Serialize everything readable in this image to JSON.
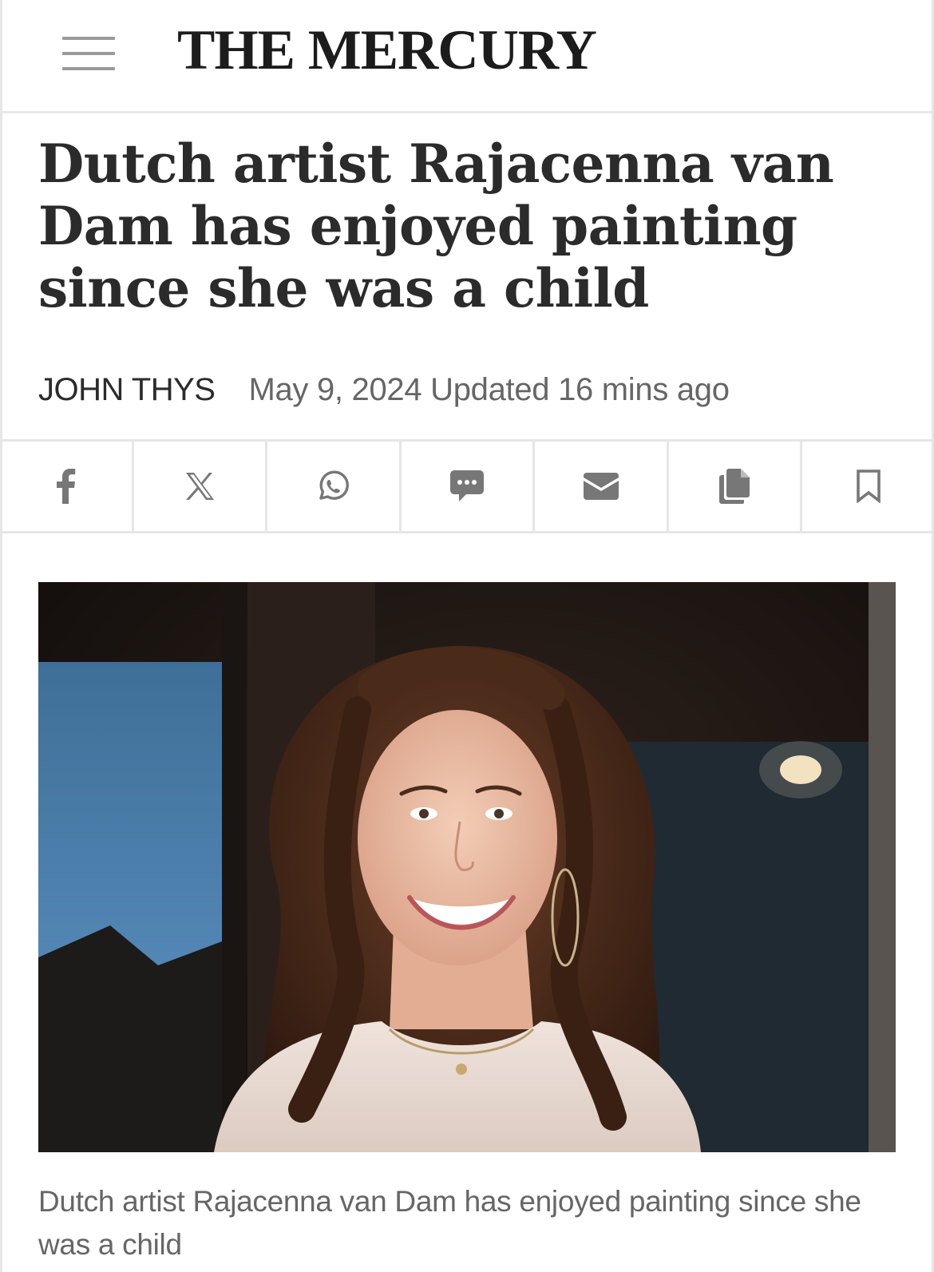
{
  "header": {
    "menu_icon": "hamburger-menu-icon",
    "brand": "THE MERCURY"
  },
  "article": {
    "headline": "Dutch artist Rajacenna van Dam has enjoyed painting since she was a child",
    "author": "JOHN THYS",
    "dateline": "May 9, 2024 Updated 16 mins ago",
    "image_caption": "Dutch artist Rajacenna van Dam has enjoyed painting since she was a child"
  },
  "share_bar": {
    "icons": [
      "facebook-icon",
      "x-icon",
      "whatsapp-icon",
      "sms-icon",
      "email-icon",
      "copy-icon",
      "bookmark-icon"
    ],
    "icon_color": "#777777"
  },
  "colors": {
    "divider": "#e6e6e6",
    "headline": "#2b2b2b",
    "meta": "#666666"
  }
}
